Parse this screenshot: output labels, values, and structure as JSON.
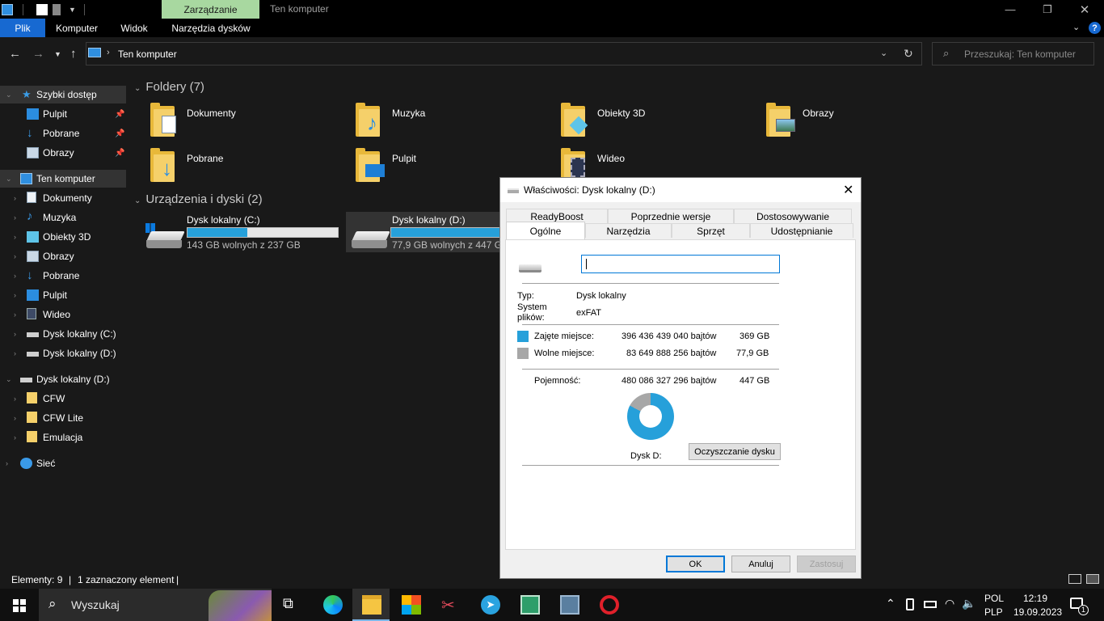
{
  "window": {
    "title": "Ten komputer",
    "context_tab": "Zarządzanie"
  },
  "ribbon": {
    "tabs": [
      "Plik",
      "Komputer",
      "Widok",
      "Narzędzia dysków"
    ]
  },
  "address": {
    "path": "Ten komputer",
    "search_placeholder": "Przeszukaj: Ten komputer"
  },
  "sidebar": {
    "quick_access": "Szybki dostęp",
    "quick_items": [
      "Pulpit",
      "Pobrane",
      "Obrazy"
    ],
    "this_pc": "Ten komputer",
    "pc_items": [
      "Dokumenty",
      "Muzyka",
      "Obiekty 3D",
      "Obrazy",
      "Pobrane",
      "Pulpit",
      "Wideo",
      "Dysk lokalny (C:)",
      "Dysk lokalny (D:)"
    ],
    "drive_d": "Dysk lokalny (D:)",
    "drive_d_items": [
      "CFW",
      "CFW Lite",
      "Emulacja"
    ],
    "network": "Sieć"
  },
  "main": {
    "folders_header": "Foldery (7)",
    "folders": [
      "Dokumenty",
      "Muzyka",
      "Obiekty 3D",
      "Obrazy",
      "Pobrane",
      "Pulpit",
      "Wideo"
    ],
    "devices_header": "Urządzenia i dyski (2)",
    "drives": [
      {
        "name": "Dysk lokalny (C:)",
        "free_text": "143 GB wolnych z 237 GB",
        "used_fraction": 0.4
      },
      {
        "name": "Dysk lokalny (D:)",
        "free_text": "77,9 GB wolnych z 447 GB",
        "used_fraction": 0.83
      }
    ]
  },
  "status": {
    "items_count": "Elementy: 9",
    "selected": "1 zaznaczony element"
  },
  "dialog": {
    "title": "Właściwości: Dysk lokalny (D:)",
    "tabs_top": [
      "ReadyBoost",
      "Poprzednie wersje",
      "Dostosowywanie"
    ],
    "tabs_bottom": [
      "Ogólne",
      "Narzędzia",
      "Sprzęt",
      "Udostępnianie"
    ],
    "type_label": "Typ:",
    "type_value": "Dysk lokalny",
    "fs_label_1": "System",
    "fs_label_2": "plików:",
    "fs_value": "exFAT",
    "used_label": "Zajęte miejsce:",
    "used_bytes": "396 436 439 040 bajtów",
    "used_gb": "369 GB",
    "free_label": "Wolne miejsce:",
    "free_bytes": "83 649 888 256 bajtów",
    "free_gb": "77,9 GB",
    "capacity_label": "Pojemność:",
    "capacity_bytes": "480 086 327 296 bajtów",
    "capacity_gb": "447 GB",
    "drive_caption": "Dysk D:",
    "cleanup_button": "Oczyszczanie dysku",
    "ok": "OK",
    "cancel": "Anuluj",
    "apply": "Zastosuj",
    "used_color": "#26a0da",
    "free_color": "#a7a7a7",
    "used_fraction": 0.826
  },
  "taskbar": {
    "search_text": "Wyszukaj",
    "lang_1": "POL",
    "lang_2": "PLP",
    "time": "12:19",
    "date": "19.09.2023",
    "notification_count": "1"
  }
}
